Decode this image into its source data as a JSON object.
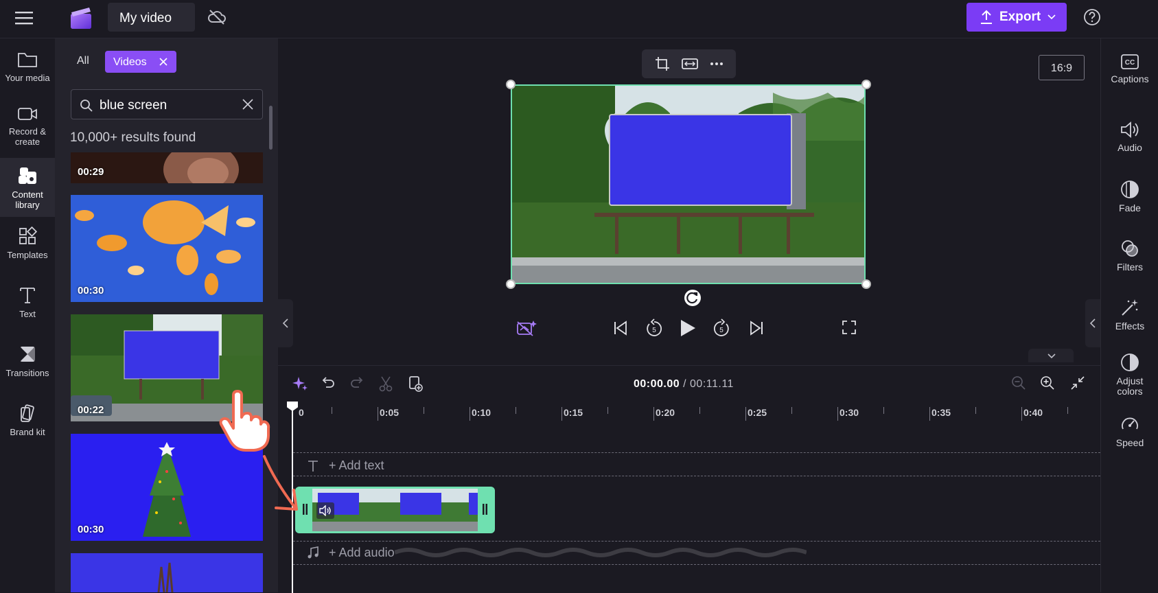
{
  "header": {
    "project_title": "My video",
    "export_label": "Export"
  },
  "left_rail": {
    "items": [
      {
        "label": "Your media",
        "icon": "folder-icon"
      },
      {
        "label": "Record &\ncreate",
        "icon": "camera-icon"
      },
      {
        "label": "Content\nlibrary",
        "icon": "content-library-icon"
      },
      {
        "label": "Templates",
        "icon": "templates-icon"
      },
      {
        "label": "Text",
        "icon": "text-icon"
      },
      {
        "label": "Transitions",
        "icon": "transitions-icon"
      },
      {
        "label": "Brand kit",
        "icon": "brand-kit-icon"
      }
    ]
  },
  "library": {
    "filter_all": "All",
    "filter_videos": "Videos",
    "search_value": "blue screen",
    "results_text": "10,000+ results found",
    "items": [
      {
        "duration": "00:29"
      },
      {
        "duration": "00:30"
      },
      {
        "duration": "00:22"
      },
      {
        "duration": "00:30"
      }
    ]
  },
  "preview": {
    "aspect_ratio": "16:9"
  },
  "right_rail": {
    "items": [
      {
        "label": "Captions",
        "icon": "captions-icon"
      },
      {
        "label": "Audio",
        "icon": "audio-icon"
      },
      {
        "label": "Fade",
        "icon": "fade-icon"
      },
      {
        "label": "Filters",
        "icon": "filters-icon"
      },
      {
        "label": "Effects",
        "icon": "effects-icon"
      },
      {
        "label": "Adjust\ncolors",
        "icon": "adjust-colors-icon"
      },
      {
        "label": "Speed",
        "icon": "speed-icon"
      }
    ]
  },
  "timeline": {
    "current_time": "00:00.00",
    "separator": " / ",
    "total_time": "00:11.11",
    "ruler": [
      "0",
      "0:05",
      "0:10",
      "0:15",
      "0:20",
      "0:25",
      "0:30",
      "0:35",
      "0:40"
    ],
    "add_text": "+ Add text",
    "add_audio": "+ Add audio"
  },
  "colors": {
    "accent": "#7b3cf5",
    "selection": "#6fe0b0",
    "chroma_blue": "#3a35e6"
  }
}
